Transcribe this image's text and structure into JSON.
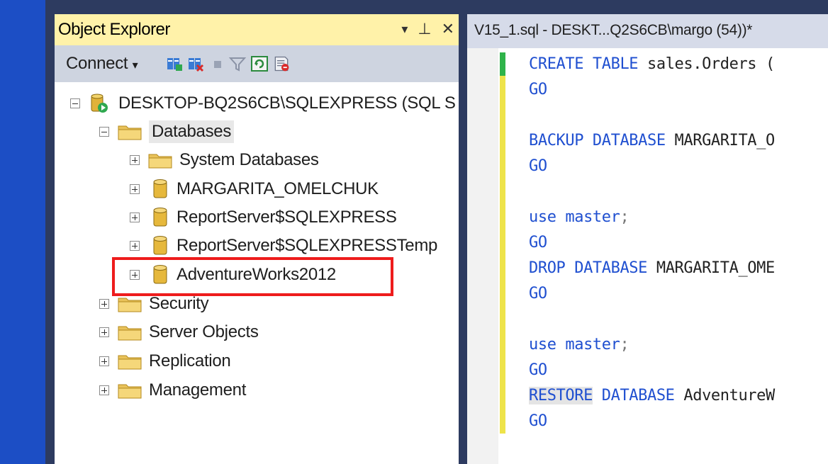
{
  "colors": {
    "keyword": "#1f4fd0",
    "highlight": "#ee1c1c",
    "title_bar": "#fff2a9",
    "toolbar": "#ced4e0",
    "change_green": "#2fb34a",
    "change_yellow": "#eee34a"
  },
  "object_explorer": {
    "title": "Object Explorer",
    "title_buttons": [
      "▾",
      "⊥",
      "✕"
    ],
    "toolbar": {
      "connect_label": "Connect",
      "connect_arrow": "▾",
      "icons": [
        "register-server-icon",
        "disconnect-icon",
        "stop-icon",
        "filter-icon",
        "refresh-icon",
        "activity-monitor-icon"
      ]
    },
    "tree": {
      "server": "DESKTOP-BQ2S6CB\\SQLEXPRESS (SQL S",
      "databases": "Databases",
      "system_databases": "System Databases",
      "db1": "MARGARITA_OMELCHUK",
      "db2": "ReportServer$SQLEXPRESS",
      "db3": "ReportServer$SQLEXPRESSTemp",
      "db4": "AdventureWorks2012",
      "security": "Security",
      "server_objects": "Server Objects",
      "replication": "Replication",
      "management": "Management"
    }
  },
  "editor": {
    "tab_title": "V15_1.sql - DESKT...Q2S6CB\\margo (54))*",
    "lines": {
      "l1_kw": "CREATE TABLE",
      "l1_rest": " sales.Orders (",
      "l2": "GO",
      "l3_kw": "BACKUP DATABASE",
      "l3_rest": " MARGARITA_O",
      "l4": "GO",
      "l5_kw": "use",
      "l5_obj": " master",
      "l5_punct": ";",
      "l6": "GO",
      "l7_kw": "DROP DATABASE",
      "l7_rest": " MARGARITA_OME",
      "l8": "GO",
      "l9_kw": "use",
      "l9_obj": " master",
      "l9_punct": ";",
      "l10": "GO",
      "l11_kw1": "RESTORE",
      "l11_kw2": " DATABASE",
      "l11_rest": " AdventureW",
      "l12": "GO"
    }
  }
}
